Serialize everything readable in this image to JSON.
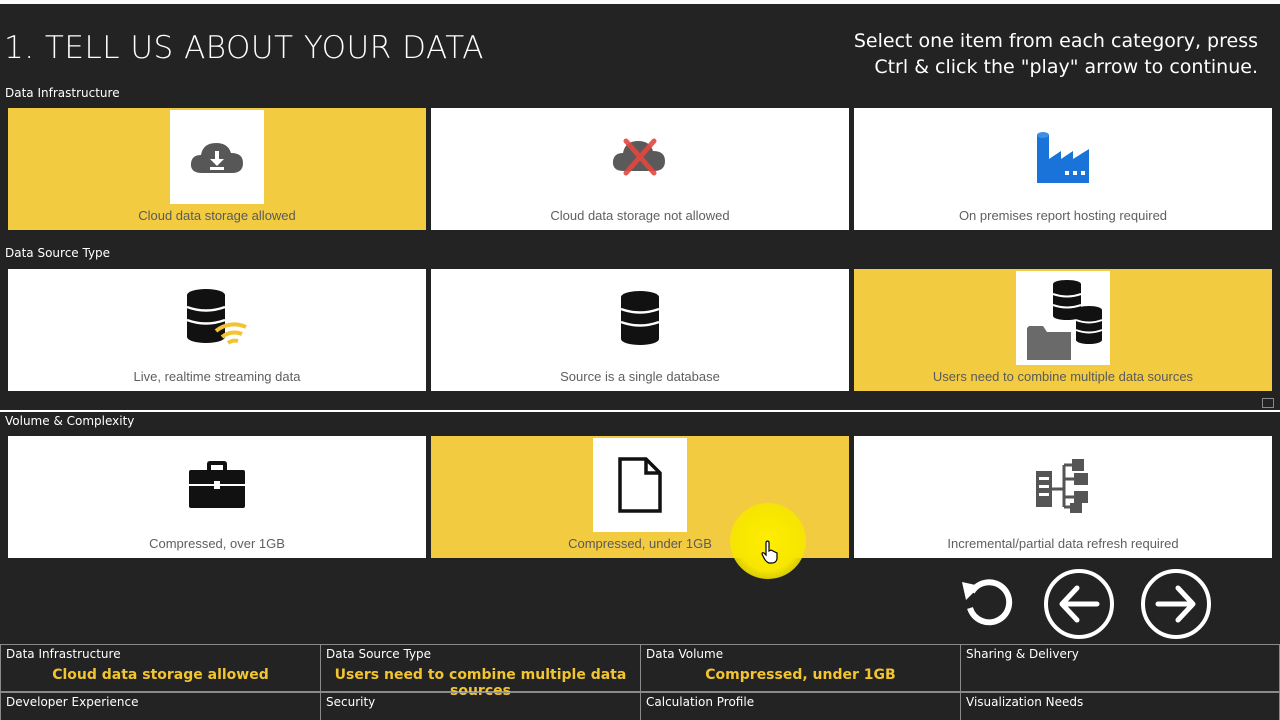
{
  "title": "1. TELL US ABOUT YOUR DATA",
  "instructions": "Select one item from each category, press Ctrl & click the \"play\" arrow to continue.",
  "sections": [
    {
      "label": "Data Infrastructure",
      "cards": [
        {
          "label": "Cloud data storage allowed",
          "icon": "cloud-download-icon",
          "selected": true
        },
        {
          "label": "Cloud data storage not allowed",
          "icon": "cloud-crossed-icon",
          "selected": false
        },
        {
          "label": "On premises report hosting required",
          "icon": "factory-icon",
          "selected": false
        }
      ]
    },
    {
      "label": "Data Source Type",
      "cards": [
        {
          "label": "Live, realtime streaming data",
          "icon": "database-wifi-icon",
          "selected": false
        },
        {
          "label": "Source is a single database",
          "icon": "database-icon",
          "selected": false
        },
        {
          "label": "Users need to combine multiple data sources",
          "icon": "multiple-databases-icon",
          "selected": true
        }
      ]
    },
    {
      "label": "Volume & Complexity",
      "cards": [
        {
          "label": "Compressed, over 1GB",
          "icon": "briefcase-icon",
          "selected": false
        },
        {
          "label": "Compressed, under 1GB",
          "icon": "document-icon",
          "selected": true
        },
        {
          "label": "Incremental/partial data refresh required",
          "icon": "server-network-icon",
          "selected": false
        }
      ]
    }
  ],
  "summary": [
    {
      "header": "Data Infrastructure",
      "value": "Cloud data storage allowed"
    },
    {
      "header": "Data Source Type",
      "value": "Users need to combine multiple data sources"
    },
    {
      "header": "Data Volume",
      "value": "Compressed, under 1GB"
    },
    {
      "header": "Sharing & Delivery",
      "value": ""
    },
    {
      "header": "Developer Experience",
      "value": ""
    },
    {
      "header": "Security",
      "value": ""
    },
    {
      "header": "Calculation Profile",
      "value": ""
    },
    {
      "header": "Visualization Needs",
      "value": ""
    }
  ],
  "nav": {
    "reset_icon": "reset-icon",
    "back_icon": "arrow-left-icon",
    "forward_icon": "arrow-right-icon"
  },
  "colors": {
    "selected": "#f2cb41",
    "summary_value": "#f2c430",
    "background": "#232323"
  }
}
